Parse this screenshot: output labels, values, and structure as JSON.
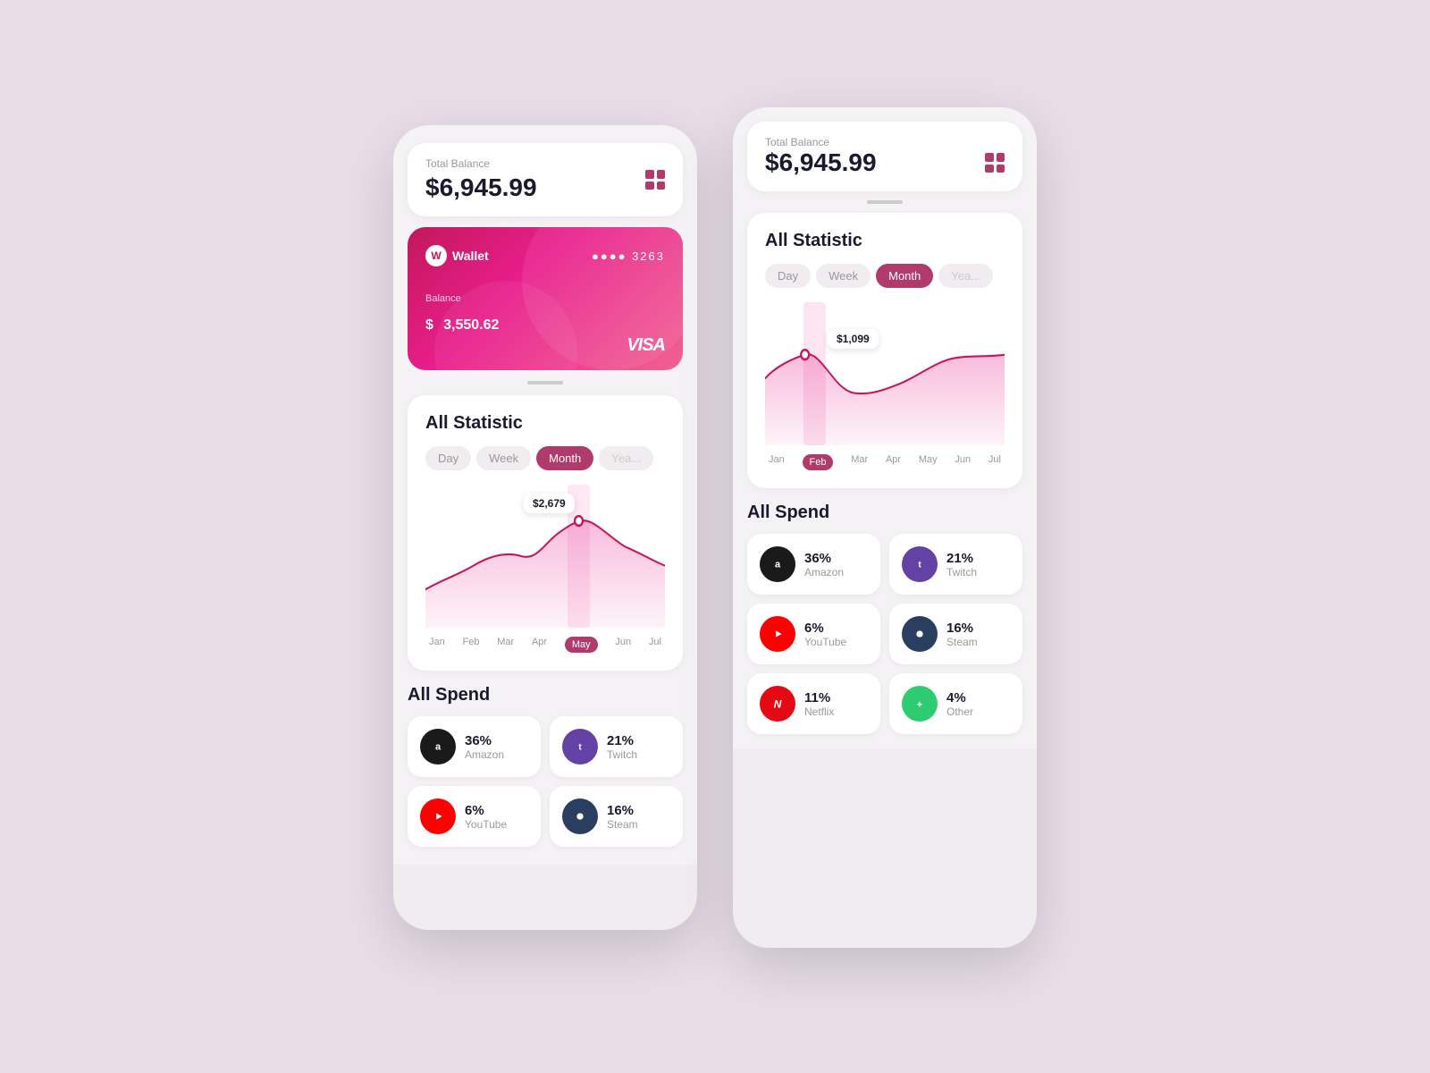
{
  "background": "#e8dde8",
  "phone_left": {
    "balance_card": {
      "label": "Total Balance",
      "amount": "$6,945.99"
    },
    "credit_card": {
      "logo": "W",
      "brand": "Wallet",
      "dots": "●●●● 3263",
      "balance_label": "Balance",
      "balance": "3,550.62",
      "currency_symbol": "$",
      "card_brand": "VISA"
    },
    "stats": {
      "title": "All Statistic",
      "tabs": [
        {
          "label": "Day",
          "state": "inactive"
        },
        {
          "label": "Week",
          "state": "inactive"
        },
        {
          "label": "Month",
          "state": "active"
        },
        {
          "label": "Yea...",
          "state": "truncated"
        }
      ],
      "chart_tooltip": "$2,679",
      "months": [
        "Jan",
        "Feb",
        "Mar",
        "Apr",
        "May",
        "Jun",
        "Jul"
      ],
      "active_month": "May"
    },
    "all_spend": {
      "title": "All Spend",
      "items": [
        {
          "name": "Amazon",
          "pct": "36%",
          "icon_type": "amazon"
        },
        {
          "name": "Twitch",
          "pct": "21%",
          "icon_type": "twitch"
        },
        {
          "name": "YouTube",
          "pct": "6%",
          "icon_type": "youtube"
        },
        {
          "name": "Steam",
          "pct": "16%",
          "icon_type": "steam"
        }
      ]
    }
  },
  "phone_right": {
    "balance_card": {
      "label": "Total Balance",
      "amount": "$6,945.99"
    },
    "stats": {
      "title": "All Statistic",
      "tabs": [
        {
          "label": "Day",
          "state": "inactive"
        },
        {
          "label": "Week",
          "state": "inactive"
        },
        {
          "label": "Month",
          "state": "active"
        },
        {
          "label": "Yea...",
          "state": "truncated"
        }
      ],
      "chart_tooltip": "$1,099",
      "months": [
        "Jan",
        "Feb",
        "Mar",
        "Apr",
        "May",
        "Jun",
        "Jul"
      ],
      "active_month": "Feb"
    },
    "all_spend": {
      "title": "All Spend",
      "items": [
        {
          "name": "Amazon",
          "pct": "36%",
          "icon_type": "amazon"
        },
        {
          "name": "Twitch",
          "pct": "21%",
          "icon_type": "twitch"
        },
        {
          "name": "YouTube",
          "pct": "6%",
          "icon_type": "youtube"
        },
        {
          "name": "Steam",
          "pct": "16%",
          "icon_type": "steam"
        },
        {
          "name": "Netflix",
          "pct": "11%",
          "icon_type": "netflix"
        },
        {
          "name": "Other",
          "pct": "4%",
          "icon_type": "green"
        }
      ]
    }
  },
  "accent_color": "#b03a6b"
}
